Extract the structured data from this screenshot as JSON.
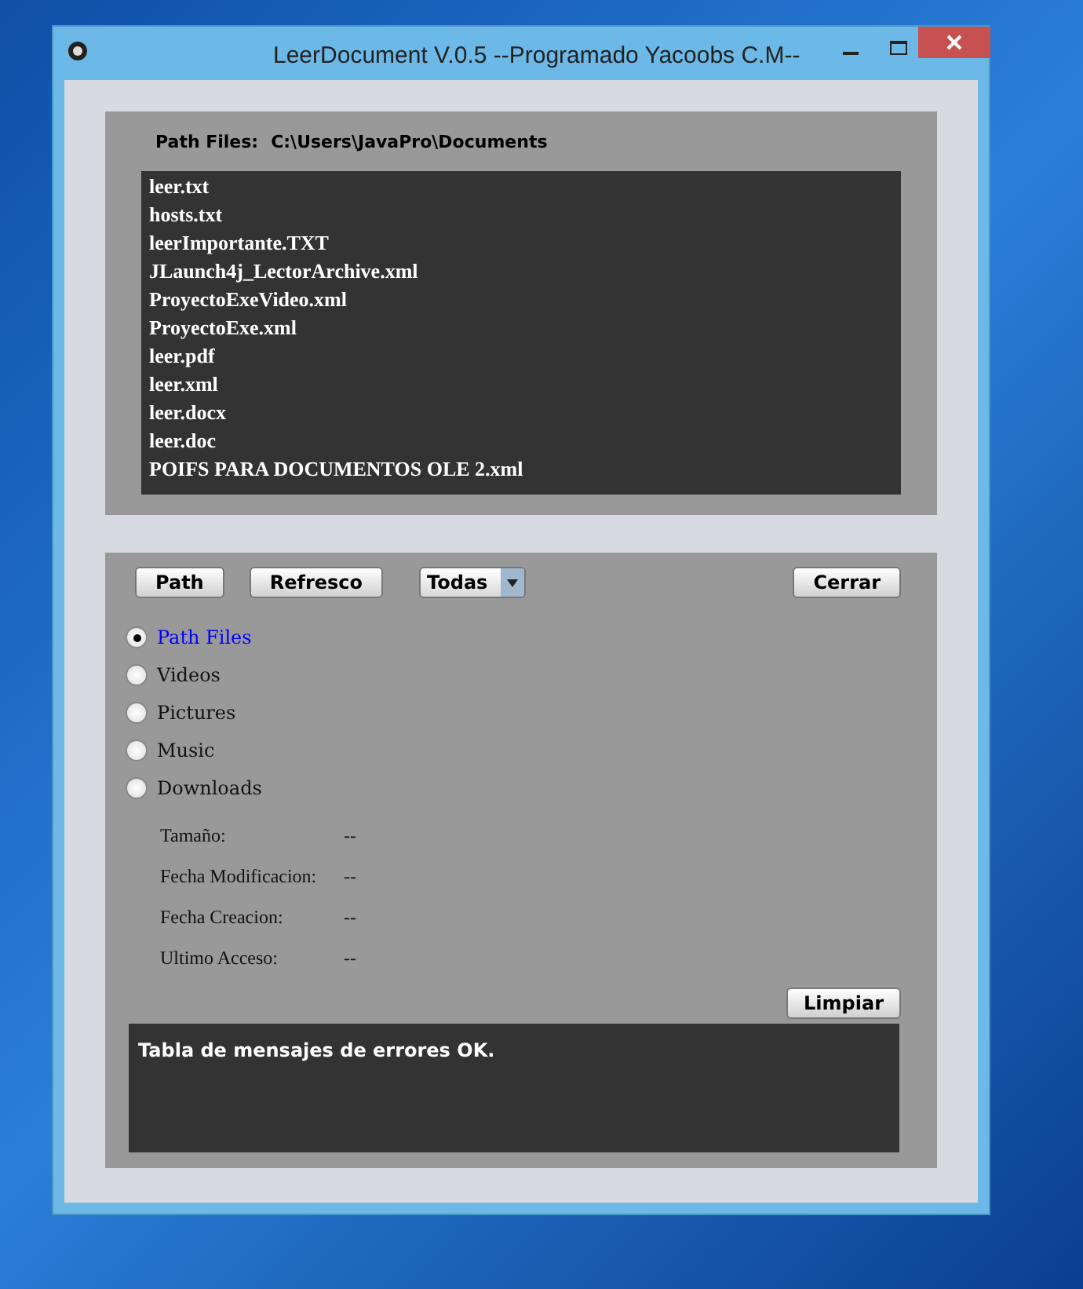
{
  "window": {
    "title": "LeerDocument V.0.5 --Programado Yacoobs C.M--"
  },
  "path": {
    "label": "Path Files:",
    "value": "C:\\Users\\JavaPro\\Documents"
  },
  "files": [
    "leer.txt",
    "hosts.txt",
    "leerImportante.TXT",
    "JLaunch4j_LectorArchive.xml",
    "ProyectoExeVideo.xml",
    "ProyectoExe.xml",
    "leer.pdf",
    "leer.xml",
    "leer.docx",
    "leer.doc",
    "POIFS PARA DOCUMENTOS OLE 2.xml"
  ],
  "buttons": [
    "Path",
    "Refresco"
  ],
  "filter": {
    "value": "Todas"
  },
  "close_button": "Cerrar",
  "locations": [
    {
      "label": "Path Files",
      "selected": true
    },
    {
      "label": "Videos",
      "selected": false
    },
    {
      "label": "Pictures",
      "selected": false
    },
    {
      "label": "Music",
      "selected": false
    },
    {
      "label": "Downloads",
      "selected": false
    }
  ],
  "details": [
    {
      "label": "Tamaño:",
      "value": "--"
    },
    {
      "label": "Fecha Modificacion:",
      "value": "--"
    },
    {
      "label": "Fecha Creacion:",
      "value": "--"
    },
    {
      "label": "Ultimo Acceso:",
      "value": "--"
    }
  ],
  "clear_button": "Limpiar",
  "messages": "Tabla de mensajes de errores OK."
}
